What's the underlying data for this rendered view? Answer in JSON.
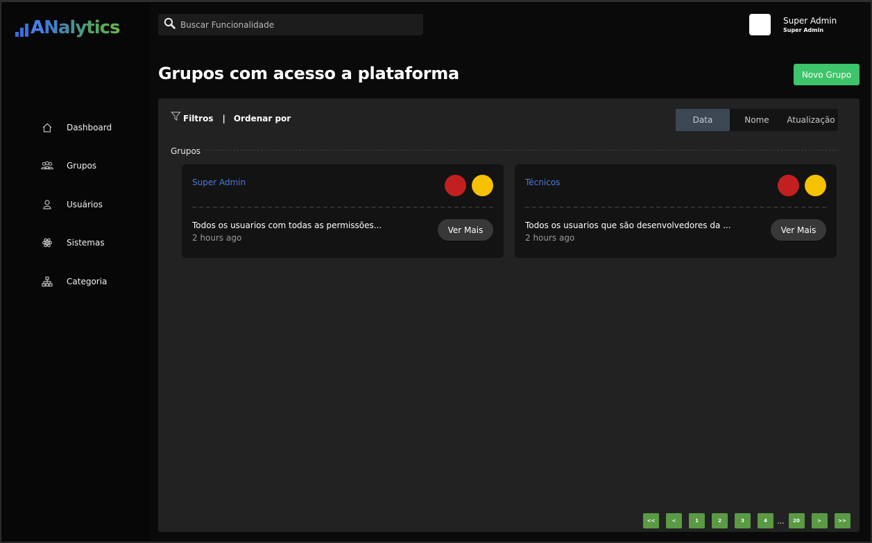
{
  "app": {
    "logo_first": "A",
    "logo_rest": "Nalytics"
  },
  "search": {
    "placeholder": "Buscar Funcionalidade"
  },
  "user": {
    "name": "Super Admin",
    "role": "Super Admin"
  },
  "page": {
    "title": "Grupos com acesso a plataforma",
    "new_button": "Novo Grupo"
  },
  "sidebar": {
    "items": [
      {
        "label": "Dashboard",
        "icon": "home-icon"
      },
      {
        "label": "Grupos",
        "icon": "users-group-icon"
      },
      {
        "label": "Usuários",
        "icon": "user-icon"
      },
      {
        "label": "Sistemas",
        "icon": "atom-icon"
      },
      {
        "label": "Categoria",
        "icon": "hierarchy-icon"
      }
    ]
  },
  "toolbar": {
    "filters_label": "Filtros",
    "separator": "|",
    "order_label": "Ordenar por",
    "sort_tabs": [
      {
        "label": "Data",
        "active": true
      },
      {
        "label": "Nome",
        "active": false
      },
      {
        "label": "Atualização",
        "active": false
      }
    ]
  },
  "section_label": "Grupos",
  "cards": [
    {
      "title": "Super Admin",
      "description": "Todos os usuarios com todas as permissões...",
      "time": "2 hours ago",
      "button": "Ver Mais",
      "dot_colors": [
        "#c1201f",
        "#f5c100"
      ]
    },
    {
      "title": "Técnicos",
      "description": "Todos os usuarios que são desenvolvedores da ...",
      "time": "2 hours ago",
      "button": "Ver Mais",
      "dot_colors": [
        "#c1201f",
        "#f5c100"
      ]
    }
  ],
  "pagination": {
    "first": "<<",
    "prev": "<",
    "pages": [
      "1",
      "2",
      "3",
      "4"
    ],
    "ellipsis": "...",
    "last_page": "20",
    "next": ">",
    "last": ">>"
  },
  "colors": {
    "accent_green": "#3ec46a",
    "link_blue": "#4a7be0",
    "pager_green": "#5a9a45"
  }
}
